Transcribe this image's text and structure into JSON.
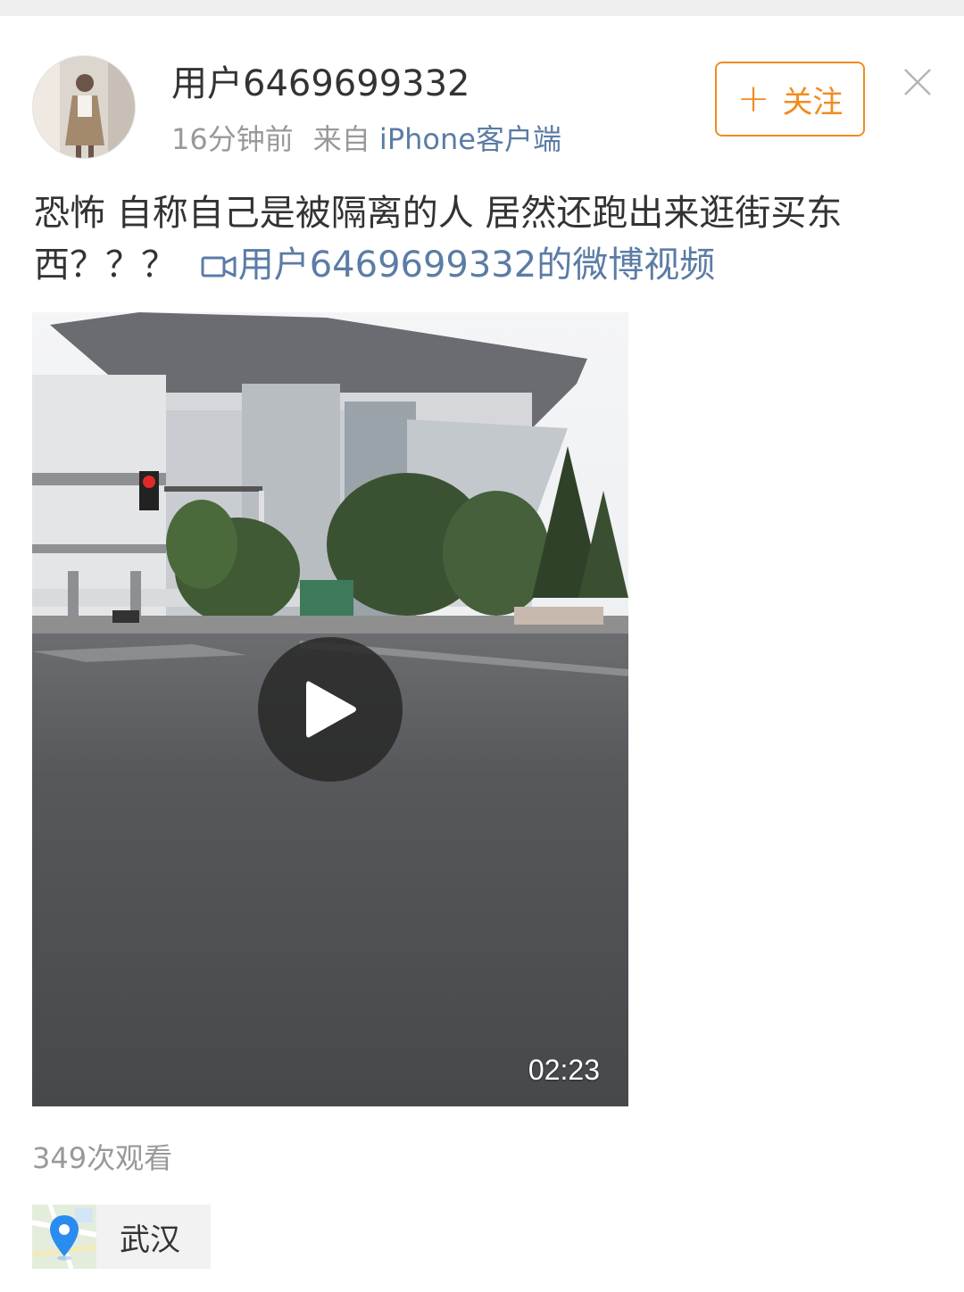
{
  "post": {
    "user": {
      "name": "用户6469699332",
      "time": "16分钟前",
      "from_label": "来自",
      "client": "iPhone客户端"
    },
    "follow_label": "关注",
    "text": "恐怖 自称自己是被隔离的人 居然还跑出来逛街买东西？？？",
    "video_link_text": "用户6469699332的微博视频",
    "video": {
      "duration": "02:23"
    },
    "views": "349次观看",
    "location": "武汉"
  },
  "icons": {
    "follow": "plus-icon",
    "close": "close-icon",
    "video_link": "video-camera-icon",
    "play": "play-icon",
    "location": "map-pin-icon"
  },
  "colors": {
    "accent_orange": "#f28b1e",
    "link_blue": "#5b7ca5",
    "meta_gray": "#999999",
    "text_dark": "#333333"
  }
}
